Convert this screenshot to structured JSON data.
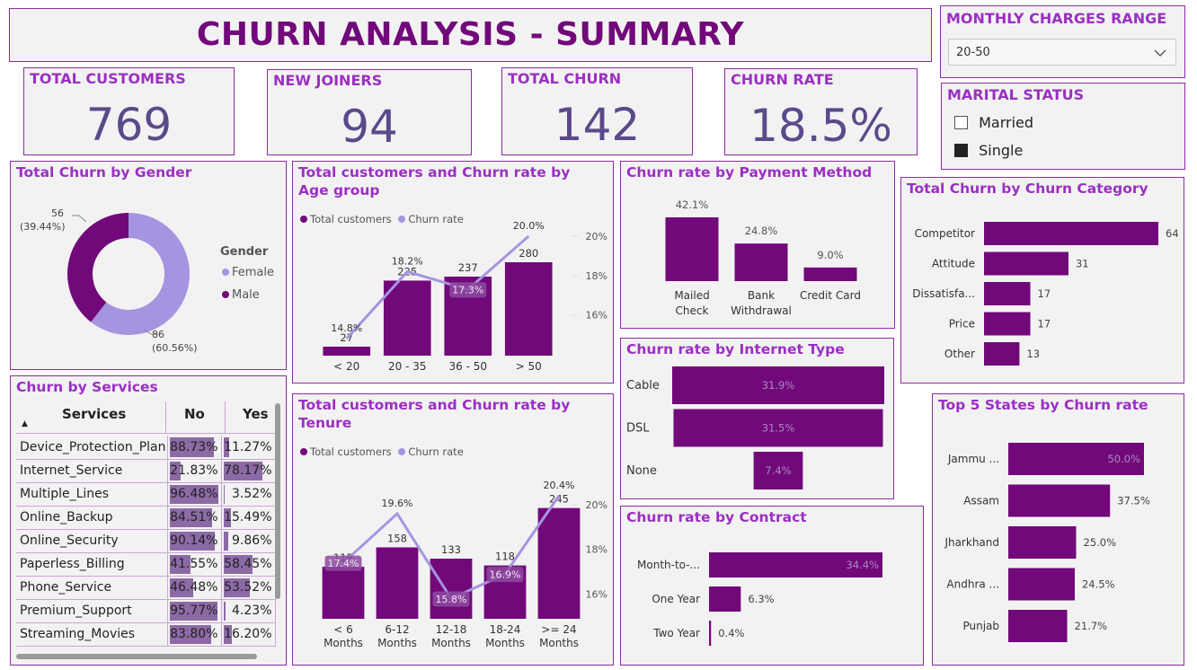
{
  "page": {
    "title": "CHURN ANALYSIS - SUMMARY"
  },
  "kpis": {
    "total_customers": {
      "label": "TOTAL CUSTOMERS",
      "value": "769"
    },
    "new_joiners": {
      "label": "NEW JOINERS",
      "value": "94"
    },
    "total_churn": {
      "label": "TOTAL CHURN",
      "value": "142"
    },
    "churn_rate": {
      "label": "CHURN RATE",
      "value": "18.5%"
    }
  },
  "filters": {
    "monthly_charges": {
      "label": "MONTHLY CHARGES RANGE",
      "value": "20-50"
    },
    "marital_status": {
      "label": "MARITAL STATUS",
      "options": [
        {
          "label": "Married",
          "checked": false
        },
        {
          "label": "Single",
          "checked": true
        }
      ]
    }
  },
  "colors": {
    "primary": "#71097a",
    "light": "#a694e0",
    "title": "#9b2fc3"
  },
  "chart_data": [
    {
      "id": "gender",
      "type": "pie",
      "title": "Total Churn by Gender",
      "legend_title": "Gender",
      "categories": [
        "Female",
        "Male"
      ],
      "values": [
        86,
        56
      ],
      "labels": [
        "86",
        "56"
      ],
      "pct_labels": [
        "(60.56%)",
        "(39.44%)"
      ],
      "colors": [
        "#a694e0",
        "#71097a"
      ],
      "legend": "right"
    },
    {
      "id": "age",
      "type": "bar",
      "title": "Total customers and Churn rate by Age group",
      "categories": [
        "< 20",
        "20 - 35",
        "36 - 50",
        "> 50"
      ],
      "series": [
        {
          "name": "Total customers",
          "values": [
            27,
            225,
            237,
            280
          ],
          "labels": [
            "27",
            "225",
            "237",
            "280"
          ]
        },
        {
          "name": "Churn rate",
          "values": [
            14.8,
            18.2,
            17.3,
            20.0
          ],
          "labels": [
            "14.8%",
            "18.2%",
            "17.3%",
            "20.0%"
          ]
        }
      ],
      "y2_ticks": [
        "20%",
        "18%",
        "16%"
      ],
      "y2_tick_values": [
        20,
        18,
        16
      ],
      "legend": "top-left"
    },
    {
      "id": "payment",
      "type": "bar",
      "title": "Churn rate by Payment Method",
      "categories": [
        "Mailed Check",
        "Bank Withdrawal",
        "Credit Card"
      ],
      "values": [
        42.1,
        24.8,
        9.0
      ],
      "labels": [
        "42.1%",
        "24.8%",
        "9.0%"
      ]
    },
    {
      "id": "category",
      "type": "bar",
      "orientation": "horizontal",
      "title": "Total Churn by Churn Category",
      "categories": [
        "Competitor",
        "Attitude",
        "Dissatisfa...",
        "Price",
        "Other"
      ],
      "values": [
        64,
        31,
        17,
        17,
        13
      ],
      "labels": [
        "64",
        "31",
        "17",
        "17",
        "13"
      ]
    },
    {
      "id": "internet",
      "type": "bar",
      "orientation": "horizontal-centered",
      "title": "Churn rate by Internet Type",
      "categories": [
        "Cable",
        "DSL",
        "None"
      ],
      "values": [
        31.9,
        31.5,
        7.4
      ],
      "labels": [
        "31.9%",
        "31.5%",
        "7.4%"
      ]
    },
    {
      "id": "tenure",
      "type": "bar",
      "title": "Total customers and Churn rate by Tenure",
      "categories": [
        "< 6 Months",
        "6-12 Months",
        "12-18 Months",
        "18-24 Months",
        ">= 24 Months"
      ],
      "series": [
        {
          "name": "Total customers",
          "values": [
            115,
            158,
            133,
            118,
            245
          ],
          "labels": [
            "115",
            "158",
            "133",
            "118",
            "245"
          ]
        },
        {
          "name": "Churn rate",
          "values": [
            17.4,
            19.6,
            15.8,
            16.9,
            20.4
          ],
          "labels": [
            "17.4%",
            "19.6%",
            "15.8%",
            "16.9%",
            "20.4%"
          ]
        }
      ],
      "y2_ticks": [
        "20%",
        "18%",
        "16%"
      ],
      "y2_tick_values": [
        20,
        18,
        16
      ],
      "legend": "top-left"
    },
    {
      "id": "contract",
      "type": "bar",
      "orientation": "horizontal",
      "title": "Churn rate by Contract",
      "categories": [
        "Month-to-...",
        "One Year",
        "Two Year"
      ],
      "values": [
        34.4,
        6.3,
        0.4
      ],
      "labels": [
        "34.4%",
        "6.3%",
        "0.4%"
      ]
    },
    {
      "id": "states",
      "type": "bar",
      "orientation": "horizontal",
      "title": "Top 5 States by Churn rate",
      "categories": [
        "Jammu ...",
        "Assam",
        "Jharkhand",
        "Andhra ...",
        "Punjab"
      ],
      "values": [
        50.0,
        37.5,
        25.0,
        24.5,
        21.7
      ],
      "labels": [
        "50.0%",
        "37.5%",
        "25.0%",
        "24.5%",
        "21.7%"
      ]
    },
    {
      "id": "services",
      "type": "table",
      "title": "Churn by Services",
      "columns": [
        "Services",
        "No",
        "Yes"
      ],
      "rows": [
        {
          "service": "Device_Protection_Plan",
          "no": 88.73,
          "no_label": "88.73%",
          "yes": 11.27,
          "yes_label": "11.27%"
        },
        {
          "service": "Internet_Service",
          "no": 21.83,
          "no_label": "21.83%",
          "yes": 78.17,
          "yes_label": "78.17%"
        },
        {
          "service": "Multiple_Lines",
          "no": 96.48,
          "no_label": "96.48%",
          "yes": 3.52,
          "yes_label": "3.52%"
        },
        {
          "service": "Online_Backup",
          "no": 84.51,
          "no_label": "84.51%",
          "yes": 15.49,
          "yes_label": "15.49%"
        },
        {
          "service": "Online_Security",
          "no": 90.14,
          "no_label": "90.14%",
          "yes": 9.86,
          "yes_label": "9.86%"
        },
        {
          "service": "Paperless_Billing",
          "no": 41.55,
          "no_label": "41.55%",
          "yes": 58.45,
          "yes_label": "58.45%"
        },
        {
          "service": "Phone_Service",
          "no": 46.48,
          "no_label": "46.48%",
          "yes": 53.52,
          "yes_label": "53.52%"
        },
        {
          "service": "Premium_Support",
          "no": 95.77,
          "no_label": "95.77%",
          "yes": 4.23,
          "yes_label": "4.23%"
        },
        {
          "service": "Streaming_Movies",
          "no": 83.8,
          "no_label": "83.80%",
          "yes": 16.2,
          "yes_label": "16.20%"
        }
      ]
    }
  ]
}
